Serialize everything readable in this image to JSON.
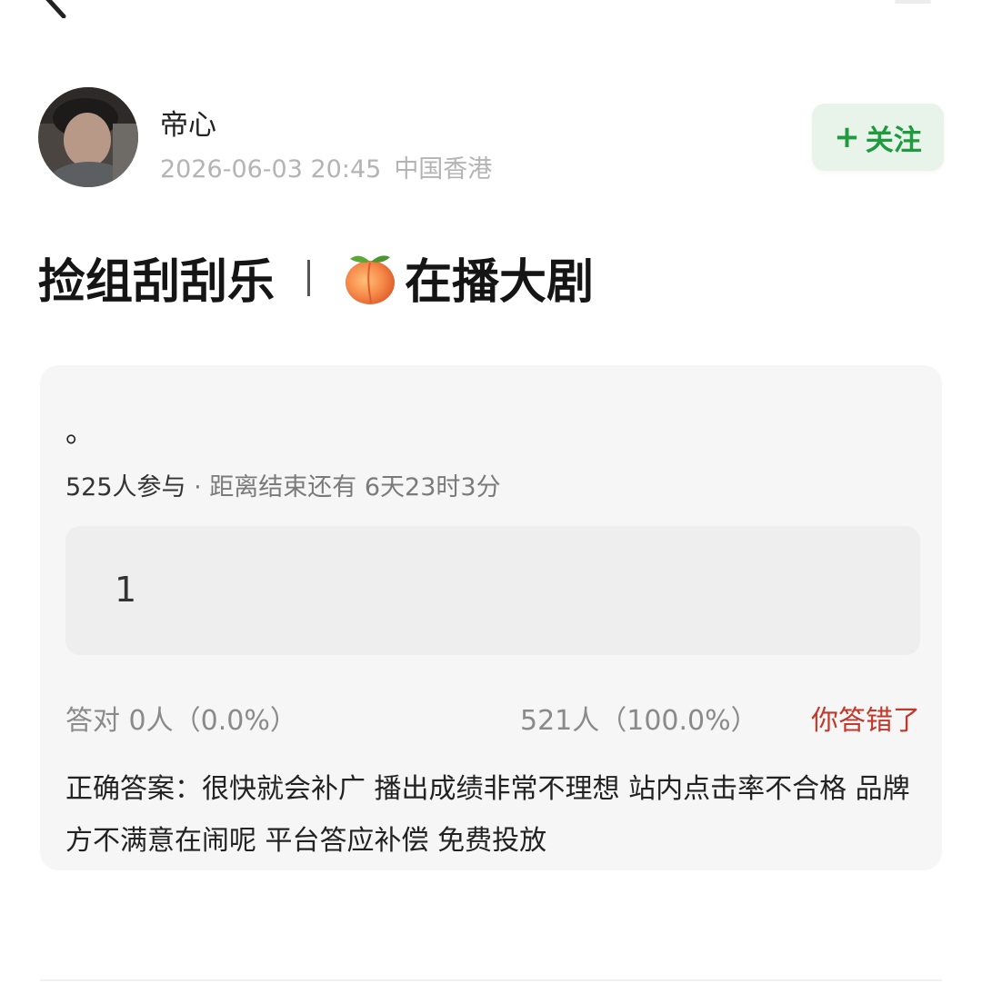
{
  "author": {
    "name": "帝心",
    "timestamp": "2026-06-03 20:45",
    "location": "中国香港",
    "follow_label": "关注",
    "follow_plus": "+"
  },
  "post": {
    "title_part1": "捡组刮刮乐",
    "title_part2": "在播大剧"
  },
  "poll": {
    "question": "。",
    "participants": "525人参与",
    "separator": " · ",
    "time_left": "距离结束还有 6天23时3分",
    "option_label": "1",
    "correct_stat": "答对 0人（0.0%）",
    "wrong_stat": "521人（100.0%）",
    "wrong_note": "你答错了",
    "answer_text": "正确答案：很快就会补广 播出成绩非常不理想 站内点击率不合格 品牌方不满意在闹呢 平台答应补偿 免费投放"
  },
  "colors": {
    "accent_green": "#1f9a3e",
    "follow_bg": "#e8f4ea",
    "wrong_red": "#c0392b",
    "card_bg": "#f6f6f6"
  },
  "icons": [
    "back-arrow-icon",
    "peach-icon"
  ]
}
